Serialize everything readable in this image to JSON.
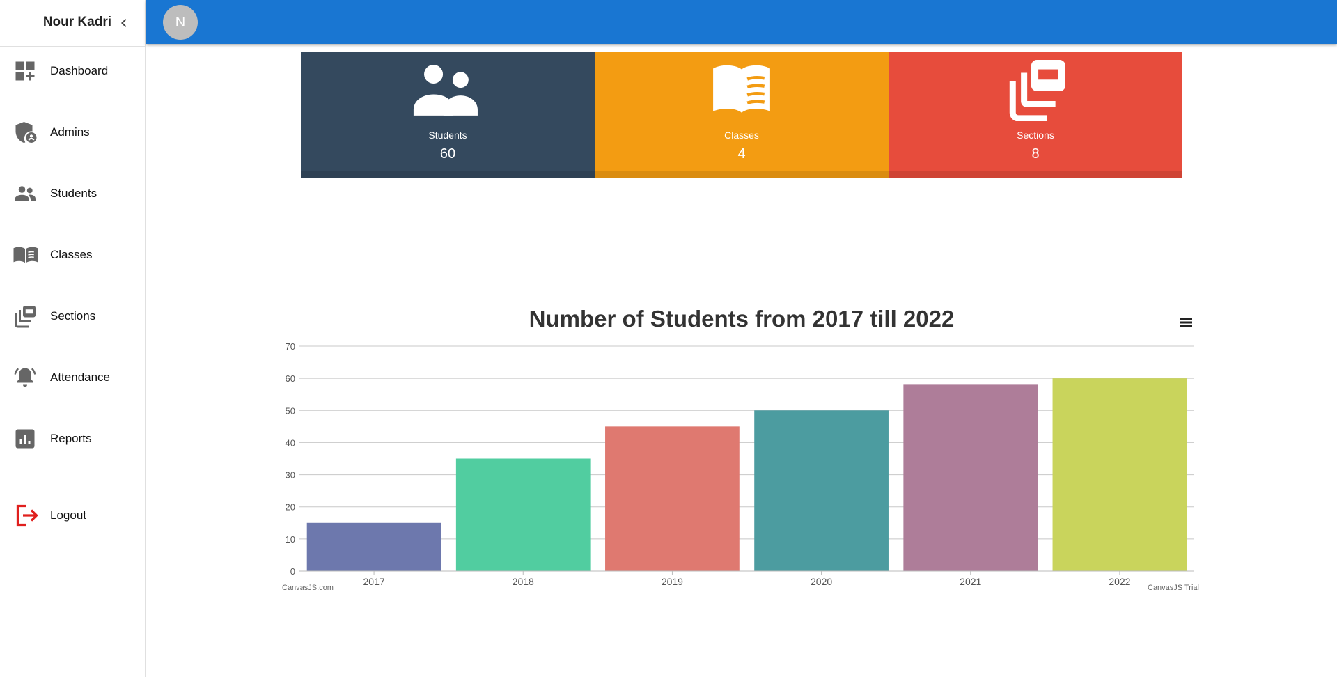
{
  "sidebar": {
    "user_name": "Nour Kadri",
    "collapse_icon": "chevron-left-icon",
    "items": [
      {
        "label": "Dashboard",
        "icon": "dashboard-add-icon"
      },
      {
        "label": "Admins",
        "icon": "admin-shield-icon"
      },
      {
        "label": "Students",
        "icon": "people-icon"
      },
      {
        "label": "Classes",
        "icon": "open-book-icon"
      },
      {
        "label": "Sections",
        "icon": "library-stack-icon"
      },
      {
        "label": "Attendance",
        "icon": "bell-ring-icon"
      },
      {
        "label": "Reports",
        "icon": "bar-chart-icon"
      }
    ],
    "logout": {
      "label": "Logout",
      "icon": "logout-icon",
      "color": "#e0201e"
    }
  },
  "topbar": {
    "avatar_initial": "N",
    "color": "#1976d2"
  },
  "cards": [
    {
      "label": "Students",
      "value": "60",
      "color": "#34495e",
      "icon": "people-icon"
    },
    {
      "label": "Classes",
      "value": "4",
      "color": "#f39c12",
      "icon": "open-book-icon"
    },
    {
      "label": "Sections",
      "value": "8",
      "color": "#e74c3c",
      "icon": "library-stack-icon"
    }
  ],
  "chart_data": {
    "type": "bar",
    "title": "Number of Students from 2017 till 2022",
    "categories": [
      "2017",
      "2018",
      "2019",
      "2020",
      "2021",
      "2022"
    ],
    "values": [
      15,
      35,
      45,
      50,
      58,
      60
    ],
    "colors": [
      "#6d78ad",
      "#51cda0",
      "#df7970",
      "#4c9ca0",
      "#ae7d99",
      "#c9d45c"
    ],
    "ylim": [
      0,
      70
    ],
    "yticks": [
      0,
      10,
      20,
      30,
      40,
      50,
      60,
      70
    ],
    "grid": true,
    "menu_icon": "hamburger-menu-icon",
    "credit_left": "CanvasJS.com",
    "credit_right": "CanvasJS Trial"
  }
}
